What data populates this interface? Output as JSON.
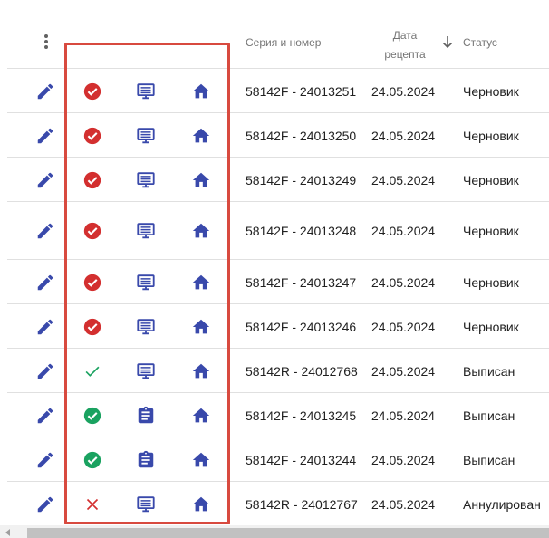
{
  "header": {
    "col_series": "Серия и номер",
    "col_date_line1": "Дата",
    "col_date_line2": "рецепта",
    "col_status": "Статус",
    "menu_icon": "more-vert-icon",
    "sort_icon": "arrow-down-icon"
  },
  "colors": {
    "primary": "#3949ab",
    "status_error": "#d32f2f",
    "status_success": "#1aa260",
    "highlight_border": "#d84a3f"
  },
  "rows": [
    {
      "state_icon": "check-circle-red-icon",
      "doc_icon": "list-icon",
      "series": "58142F - 24013251",
      "date": "24.05.2024",
      "status": "Черновик"
    },
    {
      "state_icon": "check-circle-red-icon",
      "doc_icon": "list-icon",
      "series": "58142F - 24013250",
      "date": "24.05.2024",
      "status": "Черновик"
    },
    {
      "state_icon": "check-circle-red-icon",
      "doc_icon": "list-icon",
      "series": "58142F - 24013249",
      "date": "24.05.2024",
      "status": "Черновик"
    },
    {
      "state_icon": "check-circle-red-icon",
      "doc_icon": "list-icon",
      "series": "58142F - 24013248",
      "date": "24.05.2024",
      "status": "Черновик"
    },
    {
      "state_icon": "check-circle-red-icon",
      "doc_icon": "list-icon",
      "series": "58142F - 24013247",
      "date": "24.05.2024",
      "status": "Черновик"
    },
    {
      "state_icon": "check-circle-red-icon",
      "doc_icon": "list-icon",
      "series": "58142F - 24013246",
      "date": "24.05.2024",
      "status": "Черновик"
    },
    {
      "state_icon": "check-green-icon",
      "doc_icon": "list-icon",
      "series": "58142R - 24012768",
      "date": "24.05.2024",
      "status": "Выписан"
    },
    {
      "state_icon": "check-circle-green-icon",
      "doc_icon": "clipboard-icon",
      "series": "58142F - 24013245",
      "date": "24.05.2024",
      "status": "Выписан"
    },
    {
      "state_icon": "check-circle-green-icon",
      "doc_icon": "clipboard-icon",
      "series": "58142F - 24013244",
      "date": "24.05.2024",
      "status": "Выписан"
    },
    {
      "state_icon": "close-red-icon",
      "doc_icon": "list-icon",
      "series": "58142R - 24012767",
      "date": "24.05.2024",
      "status": "Аннулирован"
    }
  ]
}
